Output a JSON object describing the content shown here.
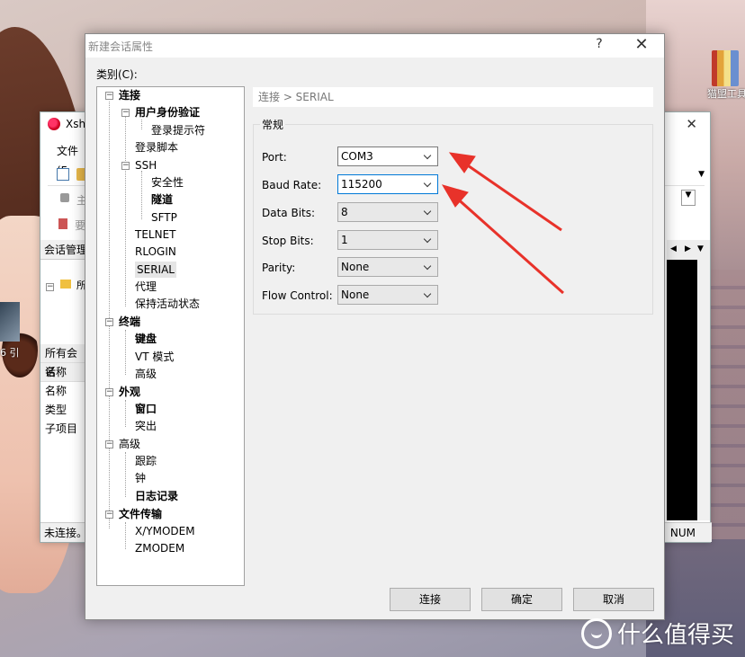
{
  "dialog": {
    "title": "新建会话属性",
    "help_label": "?",
    "close_label": "✕",
    "category_label": "类别(C):"
  },
  "tree": {
    "connection": "连接",
    "user_auth": "用户身份验证",
    "login_prompt": "登录提示符",
    "login_script": "登录脚本",
    "ssh": "SSH",
    "security": "安全性",
    "tunnel": "隧道",
    "sftp": "SFTP",
    "telnet": "TELNET",
    "rlogin": "RLOGIN",
    "serial": "SERIAL",
    "proxy": "代理",
    "keepalive": "保持活动状态",
    "terminal": "终端",
    "keyboard": "键盘",
    "vt_mode": "VT 模式",
    "terminal_advanced": "高级",
    "appearance": "外观",
    "window": "窗口",
    "highlight": "突出",
    "advanced": "高级",
    "trace": "跟踪",
    "bell": "钟",
    "logging": "日志记录",
    "file_transfer": "文件传输",
    "xymodem": "X/YMODEM",
    "zmodem": "ZMODEM"
  },
  "content": {
    "breadcrumb": "连接 > SERIAL",
    "group_title": "常规",
    "fields": [
      {
        "label": "Port:",
        "value": "COM3"
      },
      {
        "label": "Baud Rate:",
        "value": "115200"
      },
      {
        "label": "Data Bits:",
        "value": "8"
      },
      {
        "label": "Stop Bits:",
        "value": "1"
      },
      {
        "label": "Parity:",
        "value": "None"
      },
      {
        "label": "Flow Control:",
        "value": "None"
      }
    ]
  },
  "buttons": {
    "connect": "连接",
    "ok": "确定",
    "cancel": "取消"
  },
  "background_app": {
    "title": "Xsh",
    "menu": "文件(F",
    "session_manager": "会话管理",
    "tree_item": "所",
    "all_sessions": "所有会话",
    "props": [
      "名称",
      "名称",
      "类型",
      "子项目"
    ],
    "status": "未连接。",
    "num": "NUM",
    "toolbar_text1": "主",
    "toolbar_text2": "要"
  },
  "desktop": {
    "icon_label": "猫盟工具",
    "watermark": "什么值得买",
    "left_fragment": "6 引"
  },
  "colors": {
    "accent": "#0078d7",
    "annotation_arrow": "#e8322a"
  }
}
